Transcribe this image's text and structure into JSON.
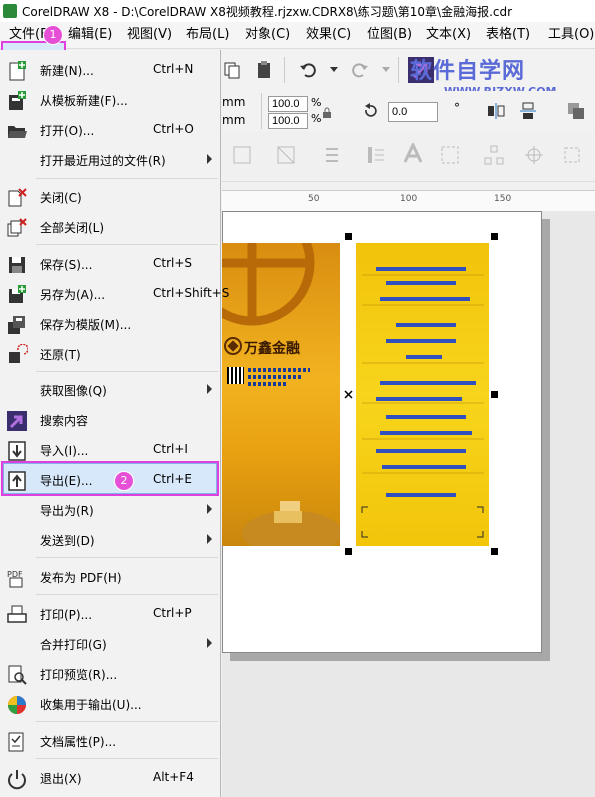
{
  "window": {
    "title": "CorelDRAW X8 - D:\\CorelDRAW X8视频教程.rjzxw.CDRX8\\练习题\\第10章\\金融海报.cdr"
  },
  "menubar": {
    "items": [
      {
        "label": "文件(F)"
      },
      {
        "label": "编辑(E)"
      },
      {
        "label": "视图(V)"
      },
      {
        "label": "布局(L)"
      },
      {
        "label": "对象(C)"
      },
      {
        "label": "效果(C)"
      },
      {
        "label": "位图(B)"
      },
      {
        "label": "文本(X)"
      },
      {
        "label": "表格(T)"
      },
      {
        "label": "工具(O)"
      }
    ],
    "badge1": "1"
  },
  "file_menu": {
    "items": [
      {
        "label": "新建(N)...",
        "shortcut": "Ctrl+N",
        "icon": "new-document-icon"
      },
      {
        "label": "从模板新建(F)...",
        "shortcut": "",
        "icon": "new-from-template-icon"
      },
      {
        "label": "打开(O)...",
        "shortcut": "Ctrl+O",
        "icon": "folder-open-icon"
      },
      {
        "label": "打开最近用过的文件(R)",
        "shortcut": "",
        "submenu": true
      },
      {
        "label": "关闭(C)",
        "shortcut": "",
        "icon": "close-document-icon"
      },
      {
        "label": "全部关闭(L)",
        "shortcut": "",
        "icon": "close-all-icon"
      },
      {
        "label": "保存(S)...",
        "shortcut": "Ctrl+S",
        "icon": "save-icon"
      },
      {
        "label": "另存为(A)...",
        "shortcut": "Ctrl+Shift+S",
        "icon": "save-as-icon"
      },
      {
        "label": "保存为模版(M)...",
        "shortcut": "",
        "icon": "save-template-icon"
      },
      {
        "label": "还原(T)",
        "shortcut": "",
        "icon": "revert-icon"
      },
      {
        "label": "获取图像(Q)",
        "shortcut": "",
        "submenu": true
      },
      {
        "label": "搜索内容",
        "shortcut": "",
        "icon": "search-content-icon"
      },
      {
        "label": "导入(I)...",
        "shortcut": "Ctrl+I",
        "icon": "import-icon"
      },
      {
        "label": "导出(E)...",
        "shortcut": "Ctrl+E",
        "icon": "export-icon"
      },
      {
        "label": "导出为(R)",
        "shortcut": "",
        "submenu": true
      },
      {
        "label": "发送到(D)",
        "shortcut": "",
        "submenu": true
      },
      {
        "label": "发布为 PDF(H)",
        "shortcut": "",
        "icon": "pdf-icon"
      },
      {
        "label": "打印(P)...",
        "shortcut": "Ctrl+P",
        "icon": "print-icon"
      },
      {
        "label": "合并打印(G)",
        "shortcut": "",
        "submenu": true
      },
      {
        "label": "打印预览(R)...",
        "shortcut": "",
        "icon": "print-preview-icon"
      },
      {
        "label": "收集用于输出(U)...",
        "shortcut": "",
        "icon": "collect-output-icon"
      },
      {
        "label": "文档属性(P)...",
        "shortcut": "",
        "icon": "document-properties-icon"
      },
      {
        "label": "退出(X)",
        "shortcut": "Alt+F4",
        "icon": "exit-icon"
      }
    ],
    "badge2": "2"
  },
  "property_bar": {
    "unit1": "mm",
    "unit2": "mm",
    "scale_x": "100.0",
    "scale_y": "100.0",
    "percent": "%",
    "rotation": "0.0",
    "degree": "°"
  },
  "ruler": {
    "ticks": [
      "50",
      "100",
      "150"
    ]
  },
  "watermark": {
    "title": "软件自学网",
    "url": "WWW.RJZXW.COM"
  },
  "poster": {
    "brand": "万鑫金融"
  },
  "colors": {
    "highlight": "#e040e0",
    "selection": "#d7e8fb",
    "badge": "#e650d6",
    "poster_gold": "#f2c30a"
  }
}
